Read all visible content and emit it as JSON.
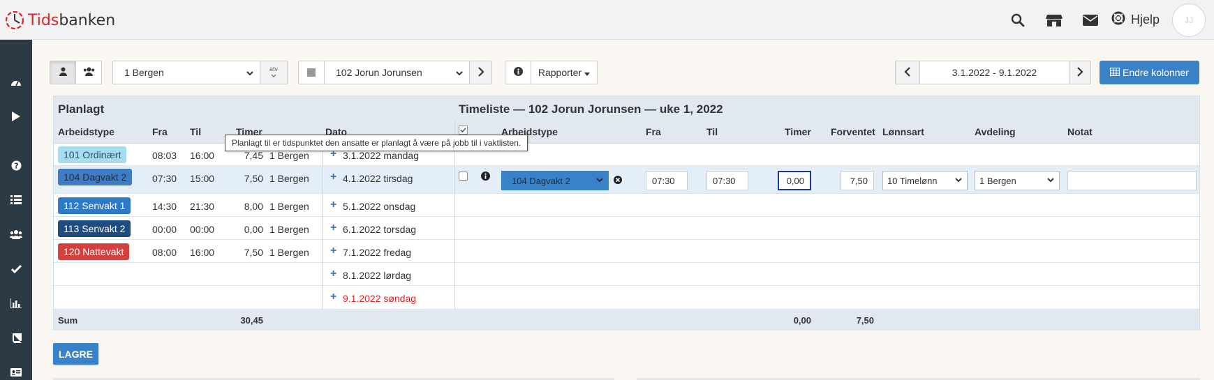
{
  "brand": {
    "part1": "Tids",
    "part2": "banken"
  },
  "header": {
    "icons": [
      "search-icon",
      "store-icon",
      "envelope-icon",
      "lifebuoy-icon"
    ],
    "help_label": "Hjelp",
    "avatar_initials": "JJ"
  },
  "sidebar": {
    "icons": [
      "dashboard-icon",
      "play-icon",
      "question-icon",
      "list-icon",
      "users-icon",
      "check-icon",
      "bar-chart-icon",
      "book-icon",
      "id-card-icon"
    ]
  },
  "toolbar": {
    "department": "1 Bergen",
    "atv_label": "atv",
    "employee": "102 Jorun Jorunsen",
    "reports_label": "Rapporter",
    "date_range": "3.1.2022 - 9.1.2022",
    "change_columns_label": "Endre kolonner"
  },
  "planned": {
    "title": "Planlagt",
    "headers": {
      "type": "Arbeidstype",
      "from": "Fra",
      "to": "Til",
      "hours": "Timer",
      "date": "Dato"
    },
    "rows": [
      {
        "type": "101 Ordinært",
        "color": "#a7dcee",
        "textcolor": "#2c5566",
        "from": "08:03",
        "to": "16:00",
        "hours": "7,45",
        "dept": "1 Bergen",
        "date": "3.1.2022 mandag"
      },
      {
        "type": "104 Dagvakt 2",
        "color": "#3f7cc4",
        "textcolor": "#1c2e4a",
        "from": "07:30",
        "to": "15:00",
        "hours": "7,50",
        "dept": "1 Bergen",
        "date": "4.1.2022 tirsdag"
      },
      {
        "type": "112 Senvakt 1",
        "color": "#2f7ac7",
        "textcolor": "#ffffff",
        "from": "14:30",
        "to": "21:30",
        "hours": "8,00",
        "dept": "1 Bergen",
        "date": "5.1.2022 onsdag"
      },
      {
        "type": "113 Senvakt 2",
        "color": "#1f4c7e",
        "textcolor": "#ffffff",
        "from": "00:00",
        "to": "00:00",
        "hours": "0,00",
        "dept": "1 Bergen",
        "date": "6.1.2022 torsdag"
      },
      {
        "type": "120 Nattevakt",
        "color": "#d2413d",
        "textcolor": "#ffffff",
        "from": "08:00",
        "to": "16:00",
        "hours": "7,50",
        "dept": "1 Bergen",
        "date": "7.1.2022 fredag"
      },
      {
        "type": "",
        "color": "",
        "textcolor": "",
        "from": "",
        "to": "",
        "hours": "",
        "dept": "",
        "date": "8.1.2022 lørdag"
      },
      {
        "type": "",
        "color": "",
        "textcolor": "",
        "from": "",
        "to": "",
        "hours": "",
        "dept": "",
        "date": "9.1.2022 søndag"
      }
    ],
    "sunday_color": "#e02020",
    "sum_label": "Sum",
    "sum_hours": "30,45"
  },
  "timesheet": {
    "title": "Timeliste — 102 Jorun Jorunsen — uke 1, 2022",
    "headers": {
      "type": "Arbeidstype",
      "from": "Fra",
      "to": "Til",
      "hours": "Timer",
      "expected": "Forventet",
      "pay_type": "Lønnsart",
      "dept": "Avdeling",
      "note": "Notat"
    },
    "entry": {
      "type": "104 Dagvakt 2",
      "from": "07:30",
      "to": "07:30",
      "hours": "0,00",
      "expected": "7,50",
      "pay_type": "10 Timelønn",
      "dept": "1 Bergen",
      "note": ""
    },
    "sum_hours": "0,00",
    "sum_expected": "7,50"
  },
  "tooltip": "Planlagt til er tidspunktet den ansatte er planlagt å være på jobb til i vaktlisten.",
  "save_label": "LAGRE"
}
